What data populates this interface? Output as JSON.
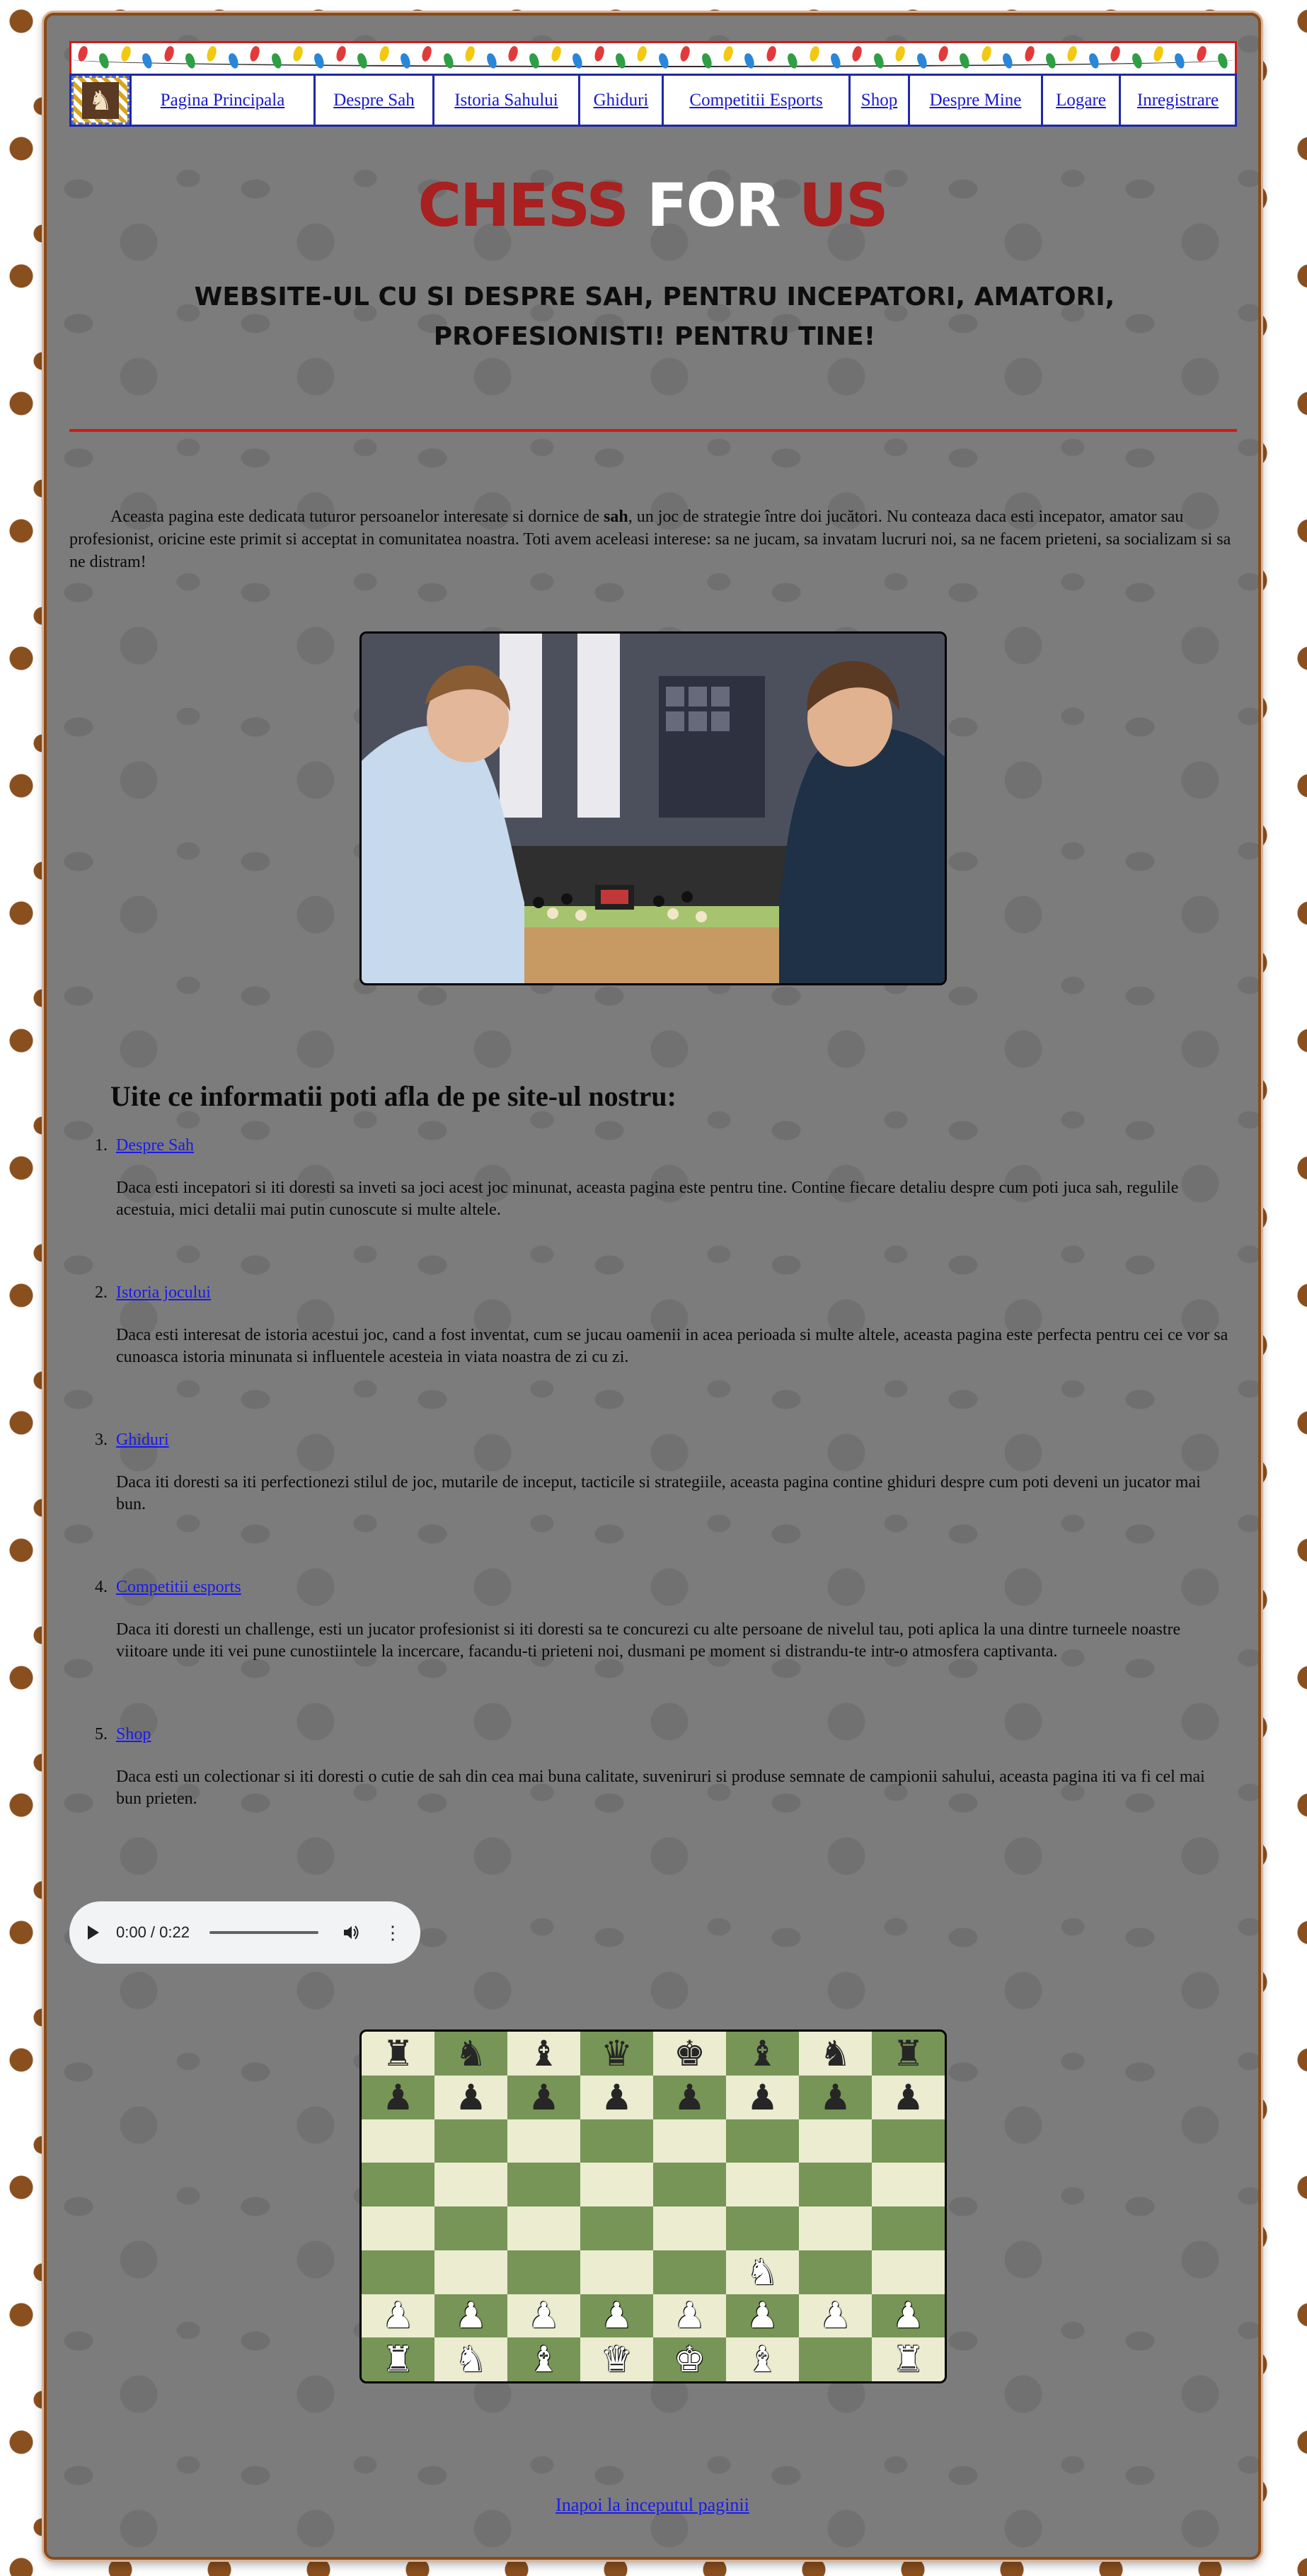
{
  "nav": {
    "logo_icon": "chess-pieces-icon",
    "items": [
      {
        "label": "Pagina Principala"
      },
      {
        "label": "Despre Sah"
      },
      {
        "label": "Istoria Sahului"
      },
      {
        "label": "Ghiduri"
      },
      {
        "label": "Competitii Esports"
      },
      {
        "label": "Shop"
      },
      {
        "label": "Despre Mine"
      },
      {
        "label": "Logare"
      },
      {
        "label": "Inregistrare"
      }
    ]
  },
  "header": {
    "title_part1": "CHESS",
    "title_part2": "FOR",
    "title_part3": "US",
    "subtitle": "Website-ul cu si despre sah, pentru incepatori, amatori, profesionisti! Pentru tine!"
  },
  "intro": {
    "before": "Aceasta pagina este dedicata tuturor persoanelor interesate si dornice de ",
    "bold": "sah",
    "after": ", un joc de strategie între doi jucători. Nu conteaza daca esti incepator, amator sau profesionist, oricine este primit si acceptat in comunitatea noastra. Toti avem aceleasi interese: sa ne jucam, sa invatam lucruri noi, sa ne facem prieteni, sa socializam si sa ne distram!"
  },
  "section_title": "Uite ce informatii poti afla de pe site-ul nostru:",
  "items": [
    {
      "num": "1.",
      "link": "Despre Sah",
      "desc": "Daca esti incepatori si iti doresti sa inveti sa joci acest joc minunat, aceasta pagina este pentru tine. Contine fiecare detaliu despre cum poti juca sah, regulile acestuia, mici detalii mai putin cunoscute si multe altele."
    },
    {
      "num": "2.",
      "link": "Istoria jocului",
      "desc": "Daca esti interesat de istoria acestui joc, cand a fost inventat, cum se jucau oamenii in acea perioada si multe altele, aceasta pagina este perfecta pentru cei ce vor sa cunoasca istoria minunata si influentele acesteia in viata noastra de zi cu zi."
    },
    {
      "num": "3.",
      "link": "Ghiduri",
      "desc": "Daca iti doresti sa iti perfectionezi stilul de joc, mutarile de inceput, tacticile si strategiile, aceasta pagina contine ghiduri despre cum poti deveni un jucator mai bun."
    },
    {
      "num": "4.",
      "link": "Competitii esports",
      "desc": "Daca iti doresti un challenge, esti un jucator profesionist si iti doresti sa te concurezi cu alte persoane de nivelul tau, poti aplica la una dintre turneele noastre viitoare unde iti vei pune cunostiintele la incercare, facandu-ti prieteni noi, dusmani pe moment si distrandu-te intr-o atmosfera captivanta."
    },
    {
      "num": "5.",
      "link": "Shop",
      "desc": "Daca esti un colectionar si iti doresti o cutie de sah din cea mai buna calitate, suveniruri si produse semnate de campionii sahului, aceasta pagina iti va fi cel mai bun prieten."
    }
  ],
  "audio": {
    "time": "0:00 / 0:22",
    "progress": 0
  },
  "board": {
    "rows": [
      [
        "br",
        "bn",
        "bb",
        "bq",
        "bk",
        "bb",
        "bn",
        "br"
      ],
      [
        "bp",
        "bp",
        "bp",
        "bp",
        "bp",
        "bp",
        "bp",
        "bp"
      ],
      [
        "",
        "",
        "",
        "",
        "",
        "",
        "",
        ""
      ],
      [
        "",
        "",
        "",
        "",
        "",
        "",
        "",
        ""
      ],
      [
        "",
        "",
        "",
        "",
        "",
        "",
        "",
        ""
      ],
      [
        "",
        "",
        "",
        "",
        "",
        "wn",
        "",
        ""
      ],
      [
        "wp",
        "wp",
        "wp",
        "wp",
        "wp",
        "wp",
        "wp",
        "wp"
      ],
      [
        "wr",
        "wn",
        "wb",
        "wq",
        "wk",
        "wb",
        "",
        "wr"
      ]
    ]
  },
  "footer": {
    "back_to_top": "Inapoi la inceputul paginii"
  },
  "colors": {
    "title_red": "#a82020",
    "nav_border": "#1f27a8",
    "divider": "#d01a1a",
    "board_light": "#ebecd0",
    "board_dark": "#779556"
  }
}
